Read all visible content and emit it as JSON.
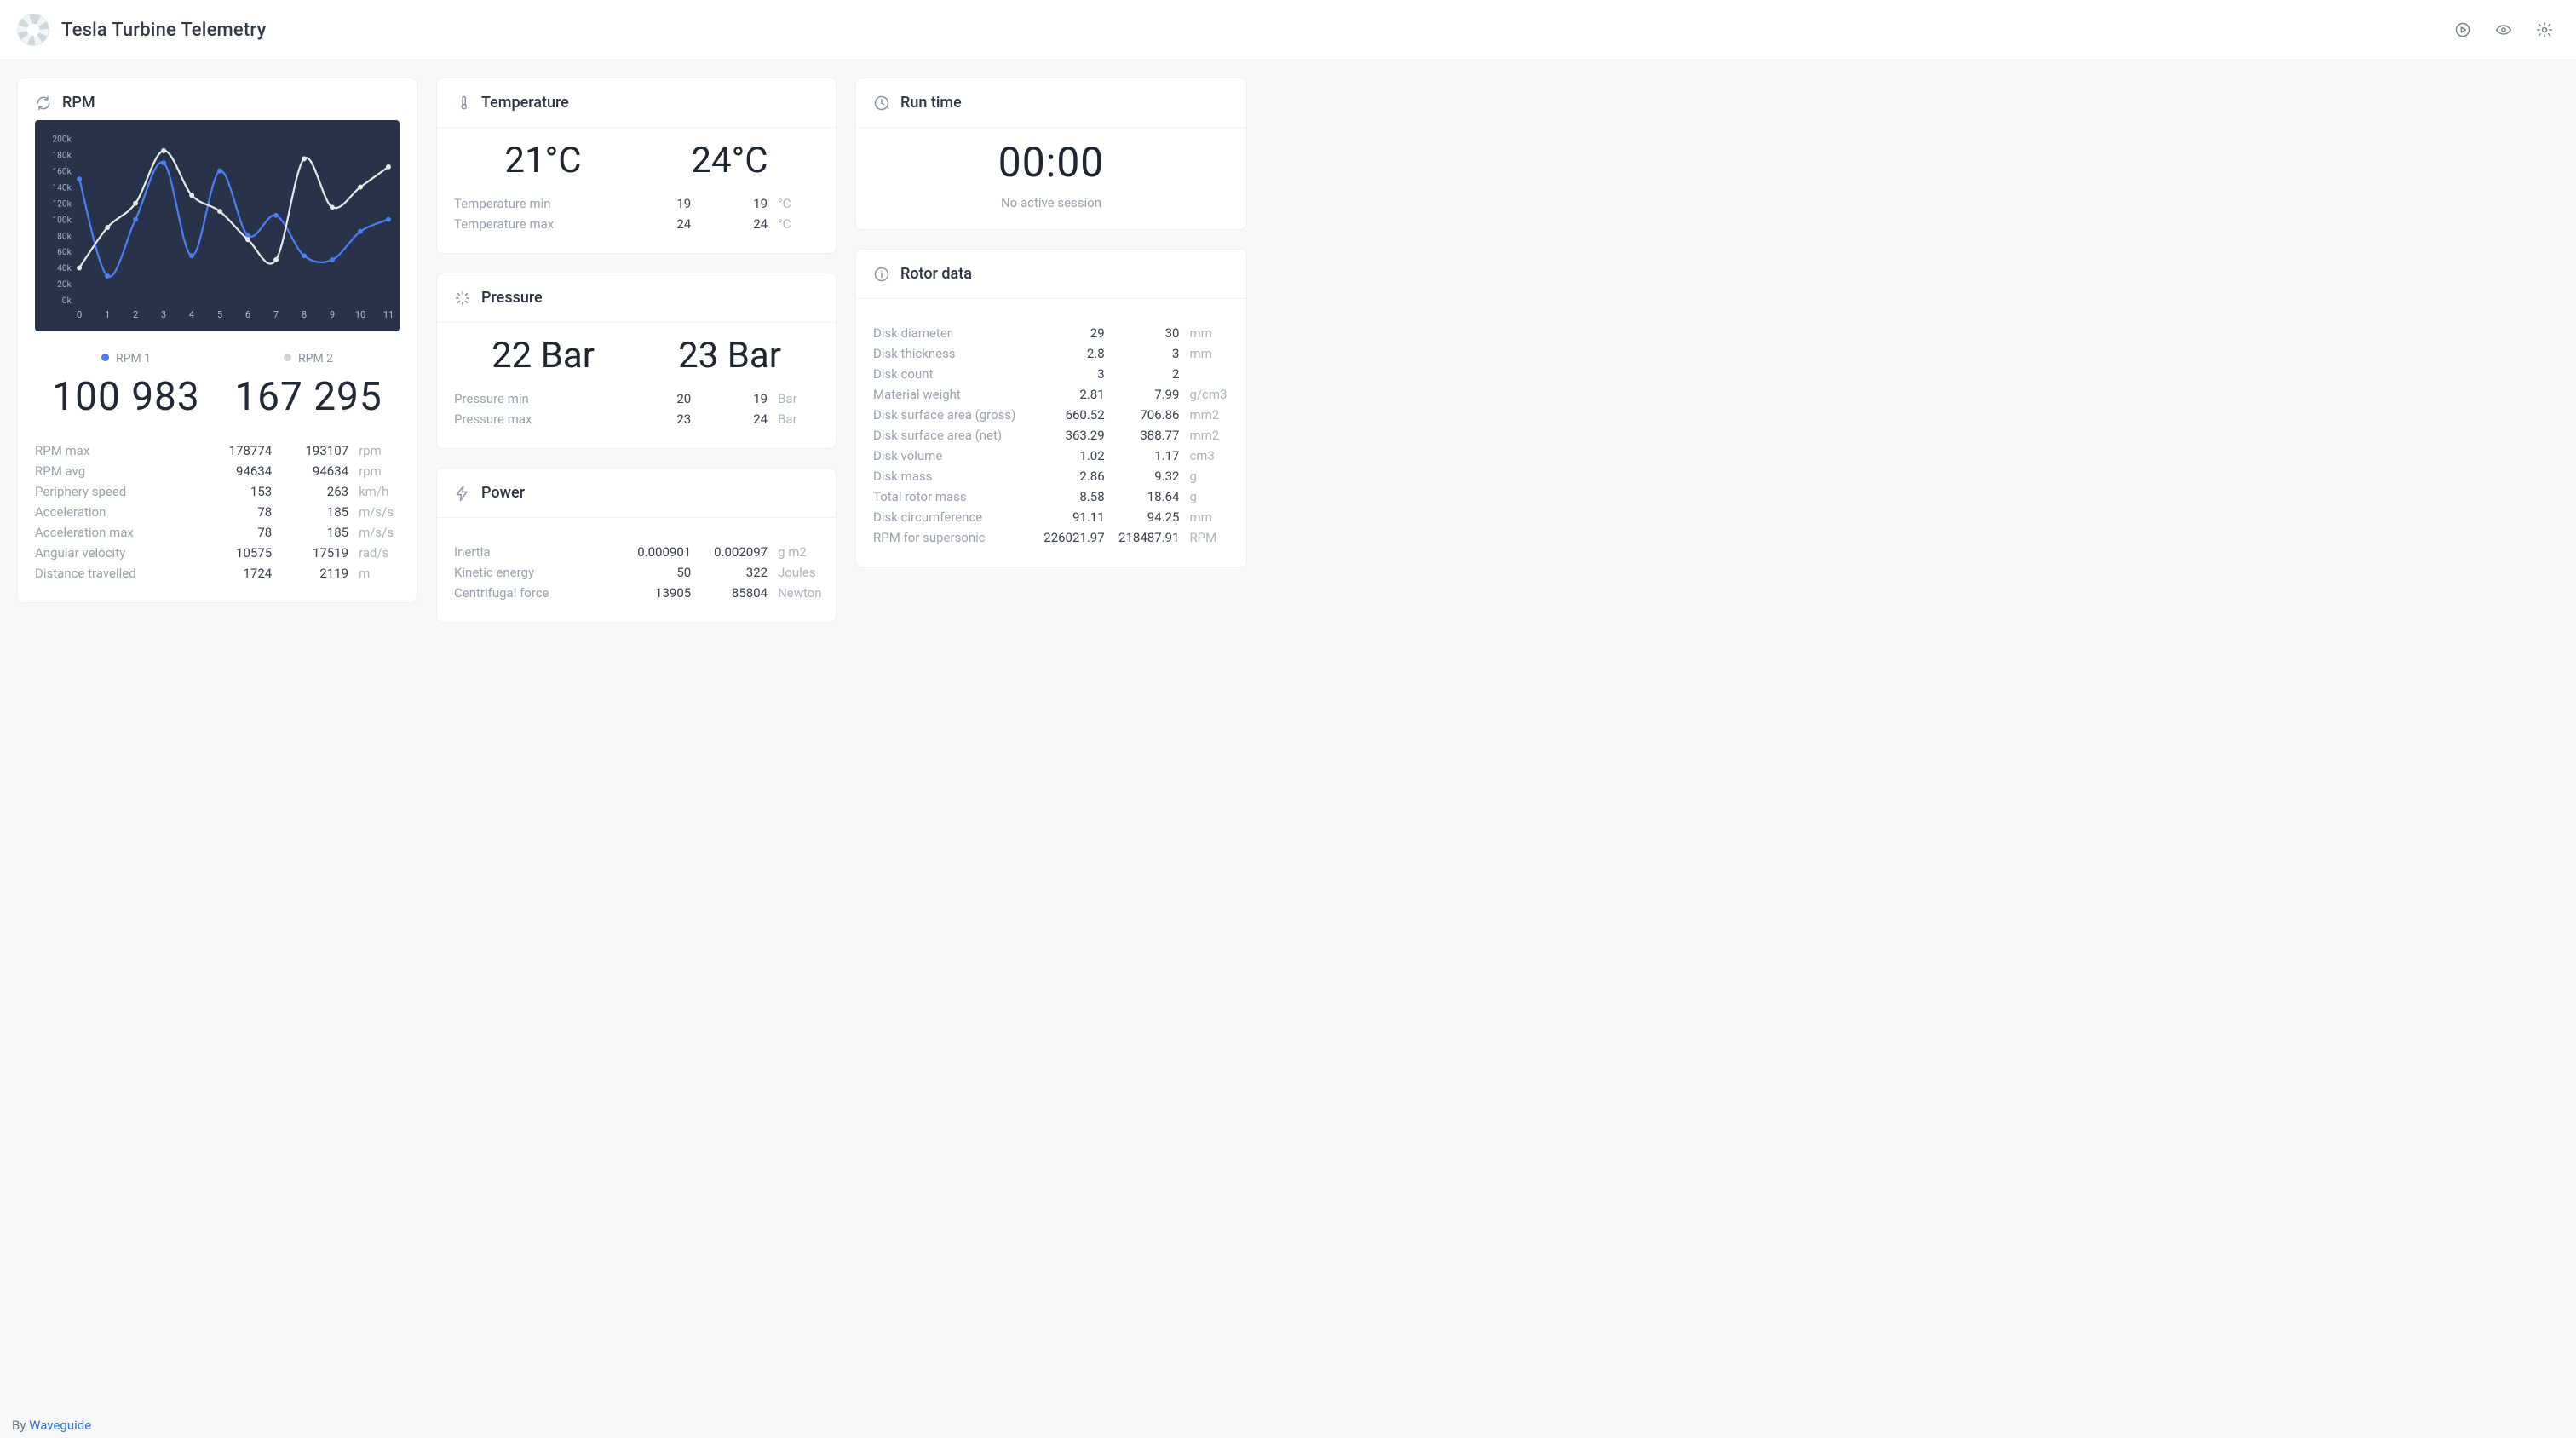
{
  "header": {
    "title": "Tesla Turbine Telemetry"
  },
  "footer": {
    "prefix": "By ",
    "link_text": "Waveguide"
  },
  "rpm_card": {
    "title": "RPM",
    "legend1": "RPM 1",
    "legend2": "RPM 2",
    "big1": "100 983",
    "big2": "167 295",
    "rows": [
      {
        "label": "RPM max",
        "v1": "178774",
        "v2": "193107",
        "unit": "rpm"
      },
      {
        "label": "RPM avg",
        "v1": "94634",
        "v2": "94634",
        "unit": "rpm"
      },
      {
        "label": "Periphery speed",
        "v1": "153",
        "v2": "263",
        "unit": "km/h"
      },
      {
        "label": "Acceleration",
        "v1": "78",
        "v2": "185",
        "unit": "m/s/s"
      },
      {
        "label": "Acceleration max",
        "v1": "78",
        "v2": "185",
        "unit": "m/s/s"
      },
      {
        "label": "Angular velocity",
        "v1": "10575",
        "v2": "17519",
        "unit": "rad/s"
      },
      {
        "label": "Distance travelled",
        "v1": "1724",
        "v2": "2119",
        "unit": "m"
      }
    ]
  },
  "temperature_card": {
    "title": "Temperature",
    "big1": "21°C",
    "big2": "24°C",
    "rows": [
      {
        "label": "Temperature min",
        "v1": "19",
        "v2": "19",
        "unit": "°C"
      },
      {
        "label": "Temperature max",
        "v1": "24",
        "v2": "24",
        "unit": "°C"
      }
    ]
  },
  "pressure_card": {
    "title": "Pressure",
    "big1": "22 Bar",
    "big2": "23 Bar",
    "rows": [
      {
        "label": "Pressure min",
        "v1": "20",
        "v2": "19",
        "unit": "Bar"
      },
      {
        "label": "Pressure max",
        "v1": "23",
        "v2": "24",
        "unit": "Bar"
      }
    ]
  },
  "power_card": {
    "title": "Power",
    "rows": [
      {
        "label": "Inertia",
        "v1": "0.000901",
        "v2": "0.002097",
        "unit": "g m2"
      },
      {
        "label": "Kinetic energy",
        "v1": "50",
        "v2": "322",
        "unit": "Joules"
      },
      {
        "label": "Centrifugal force",
        "v1": "13905",
        "v2": "85804",
        "unit": "Newton"
      }
    ]
  },
  "runtime_card": {
    "title": "Run time",
    "time": "00:00",
    "sub": "No active session"
  },
  "rotor_card": {
    "title": "Rotor data",
    "rows": [
      {
        "label": "Disk diameter",
        "v1": "29",
        "v2": "30",
        "unit": "mm"
      },
      {
        "label": "Disk thickness",
        "v1": "2.8",
        "v2": "3",
        "unit": "mm"
      },
      {
        "label": "Disk count",
        "v1": "3",
        "v2": "2",
        "unit": ""
      },
      {
        "label": "Material weight",
        "v1": "2.81",
        "v2": "7.99",
        "unit": "g/cm3"
      },
      {
        "label": "Disk surface area (gross)",
        "v1": "660.52",
        "v2": "706.86",
        "unit": "mm2"
      },
      {
        "label": "Disk surface area (net)",
        "v1": "363.29",
        "v2": "388.77",
        "unit": "mm2"
      },
      {
        "label": "Disk volume",
        "v1": "1.02",
        "v2": "1.17",
        "unit": "cm3"
      },
      {
        "label": "Disk mass",
        "v1": "2.86",
        "v2": "9.32",
        "unit": "g"
      },
      {
        "label": "Total rotor mass",
        "v1": "8.58",
        "v2": "18.64",
        "unit": "g"
      },
      {
        "label": "Disk circumference",
        "v1": "91.11",
        "v2": "94.25",
        "unit": "mm"
      },
      {
        "label": "RPM for supersonic",
        "v1": "226021.97",
        "v2": "218487.91",
        "unit": "RPM"
      }
    ]
  },
  "chart_data": {
    "type": "line",
    "title": "RPM",
    "xlabel": "",
    "ylabel": "",
    "x": [
      0,
      1,
      2,
      3,
      4,
      5,
      6,
      7,
      8,
      9,
      10,
      11
    ],
    "ylim": [
      0,
      200000
    ],
    "yticks": [
      "0k",
      "20k",
      "40k",
      "60k",
      "80k",
      "100k",
      "120k",
      "140k",
      "160k",
      "180k",
      "200k"
    ],
    "series": [
      {
        "name": "RPM 1",
        "color": "#4f7cf2",
        "values": [
          150000,
          30000,
          100000,
          170000,
          55000,
          160000,
          80000,
          105000,
          55000,
          50000,
          85000,
          100000
        ]
      },
      {
        "name": "RPM 2",
        "color": "#e4e9f0",
        "values": [
          40000,
          90000,
          120000,
          185000,
          130000,
          110000,
          75000,
          50000,
          175000,
          115000,
          140000,
          165000
        ]
      }
    ]
  }
}
